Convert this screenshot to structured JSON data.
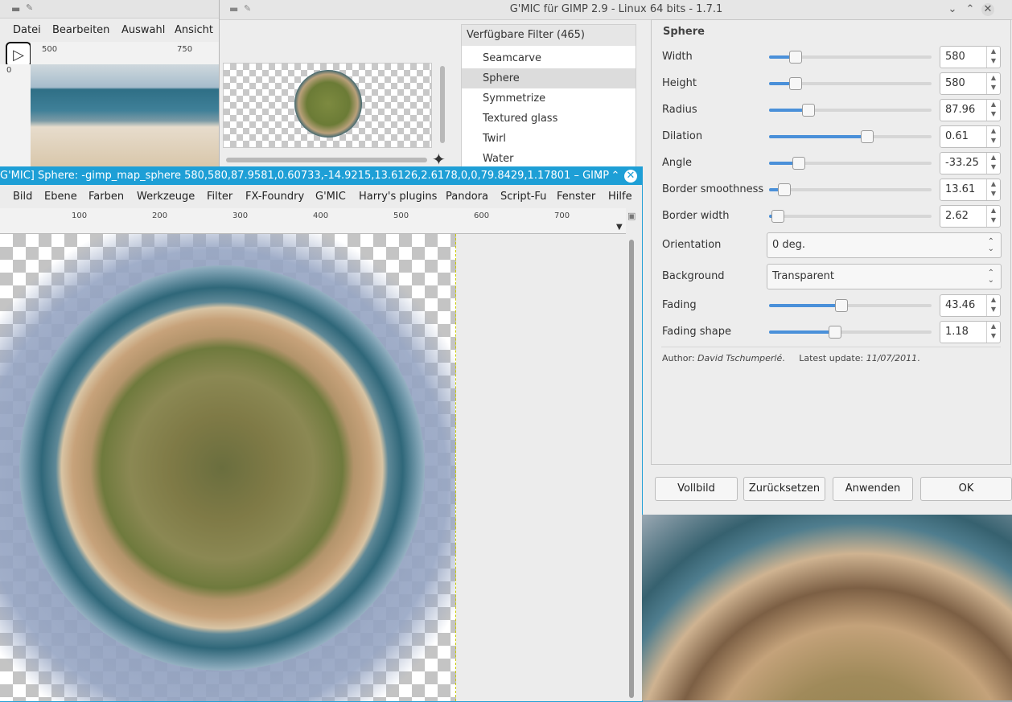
{
  "bg_gimp": {
    "menu": [
      "Datei",
      "Bearbeiten",
      "Auswahl",
      "Ansicht"
    ],
    "ruler_ticks": [
      "500",
      "750"
    ],
    "vruler_tick": "0"
  },
  "gmic": {
    "title": "G'MIC für GIMP 2.9 - Linux 64 bits - 1.7.1",
    "filter_header": "Verfügbare Filter (465)",
    "filters": [
      "Seamcarve",
      "Sphere",
      "Symmetrize",
      "Textured glass",
      "Twirl",
      "Water"
    ],
    "selected_filter": "Sphere",
    "params_title": "Sphere",
    "params": [
      {
        "label": "Width",
        "value": "580",
        "fraction": 0.16
      },
      {
        "label": "Height",
        "value": "580",
        "fraction": 0.16
      },
      {
        "label": "Radius",
        "value": "87.96",
        "fraction": 0.24
      },
      {
        "label": "Dilation",
        "value": "0.61",
        "fraction": 0.6
      },
      {
        "label": "Angle",
        "value": "-33.25",
        "fraction": 0.18
      },
      {
        "label": "Border smoothness",
        "value": "13.61",
        "fraction": 0.09
      },
      {
        "label": "Border width",
        "value": "2.62",
        "fraction": 0.05
      }
    ],
    "orientation": {
      "label": "Orientation",
      "value": "0 deg."
    },
    "background": {
      "label": "Background",
      "value": "Transparent"
    },
    "fading": [
      {
        "label": "Fading",
        "value": "43.46",
        "fraction": 0.44
      },
      {
        "label": "Fading shape",
        "value": "1.18",
        "fraction": 0.4
      }
    ],
    "author_label": "Author:",
    "author": "David Tschumperlé",
    "update_label": "Latest update:",
    "update": "11/07/2011",
    "buttons": [
      "Vollbild",
      "Zurücksetzen",
      "Anwenden",
      "OK"
    ]
  },
  "main_gimp": {
    "title": "G'MIC] Sphere: -gimp_map_sphere 580,580,87.9581,0.60733,-14.9215,13.6126,2.6178,0,0,79.8429,1.17801  – GIMP",
    "menu": [
      "Bild",
      "Ebene",
      "Farben",
      "Werkzeuge",
      "Filter",
      "FX-Foundry",
      "G'MIC",
      "Harry's plugins",
      "Pandora",
      "Script-Fu",
      "Fenster",
      "Hilfe"
    ],
    "ruler_ticks": [
      "100",
      "200",
      "300",
      "400",
      "500",
      "600",
      "700"
    ]
  },
  "colors": {
    "accent": "#1e9fd6",
    "slider_fill": "#4a90d9"
  }
}
